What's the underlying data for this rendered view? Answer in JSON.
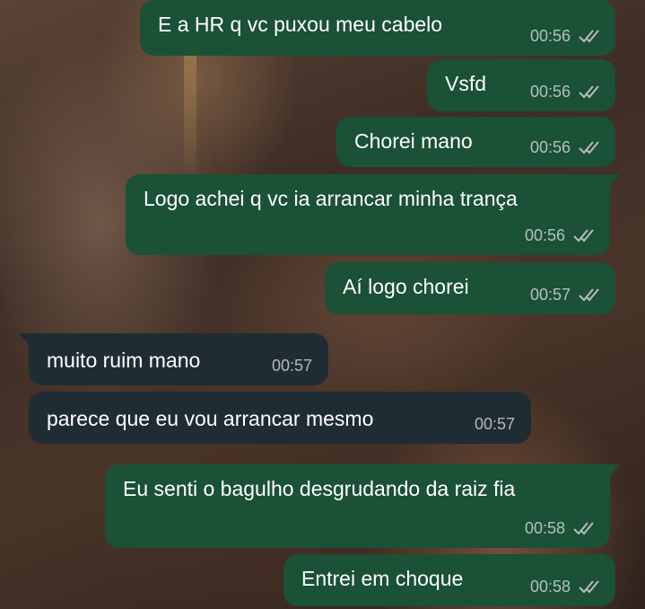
{
  "messages": [
    {
      "text": "E a HR q vc puxou meu cabelo",
      "time": "00:56",
      "status_icon": "double-check-icon",
      "direction": "outgoing"
    },
    {
      "text": "Vsfd",
      "time": "00:56",
      "status_icon": "double-check-icon",
      "direction": "outgoing"
    },
    {
      "text": "Chorei mano",
      "time": "00:56",
      "status_icon": "double-check-icon",
      "direction": "outgoing"
    },
    {
      "text": "Logo achei q vc ia arrancar minha trança",
      "time": "00:56",
      "status_icon": "double-check-icon",
      "direction": "outgoing"
    },
    {
      "text": "Aí logo chorei",
      "time": "00:57",
      "status_icon": "double-check-icon",
      "direction": "outgoing"
    },
    {
      "text": "muito ruim mano",
      "time": "00:57",
      "direction": "incoming"
    },
    {
      "text": "parece que eu vou arrancar mesmo",
      "time": "00:57",
      "direction": "incoming"
    },
    {
      "text": "Eu senti o bagulho desgrudando da raiz fia",
      "time": "00:58",
      "status_icon": "double-check-icon",
      "direction": "outgoing"
    },
    {
      "text": "Entrei em choque",
      "time": "00:58",
      "status_icon": "double-check-icon",
      "direction": "outgoing"
    }
  ],
  "colors": {
    "outgoing_bubble": "#1b5136",
    "incoming_bubble": "#202c33",
    "message_text": "#ffffff",
    "meta_text": "#b7bcbe",
    "ticks": "#b7bcbe"
  }
}
